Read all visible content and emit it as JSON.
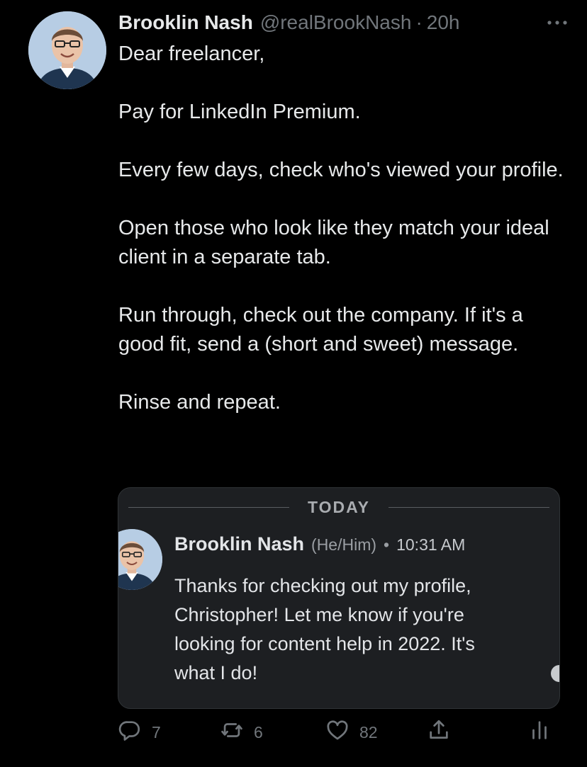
{
  "tweet": {
    "author_name": "Brooklin Nash",
    "handle": "@realBrookNash",
    "separator": "·",
    "time": "20h",
    "paragraphs": [
      "Dear freelancer,",
      "Pay for LinkedIn Premium.",
      "Every few days, check who's viewed your profile.",
      "Open those who look like they match your ideal client in a separate tab.",
      "Run through, check out the company. If it's a good fit, send a (short and sweet) message.",
      "Rinse and repeat."
    ]
  },
  "embedded_message": {
    "day_divider": "TODAY",
    "sender_name": "Brooklin Nash",
    "pronouns": "(He/Him)",
    "dot": "•",
    "time": "10:31 AM",
    "text": "Thanks for checking out my profile, Christopher! Let me know if you're looking for content help in 2022. It's what I do!"
  },
  "actions": {
    "reply_count": "7",
    "retweet_count": "6",
    "like_count": "82"
  },
  "icons": {
    "more": "more-icon",
    "reply": "reply-icon",
    "retweet": "retweet-icon",
    "like": "heart-icon",
    "share": "share-icon",
    "analytics": "analytics-icon"
  },
  "colors": {
    "background": "#000000",
    "text": "#e7e9ea",
    "muted": "#71767b",
    "card_background": "#1d1f22"
  }
}
